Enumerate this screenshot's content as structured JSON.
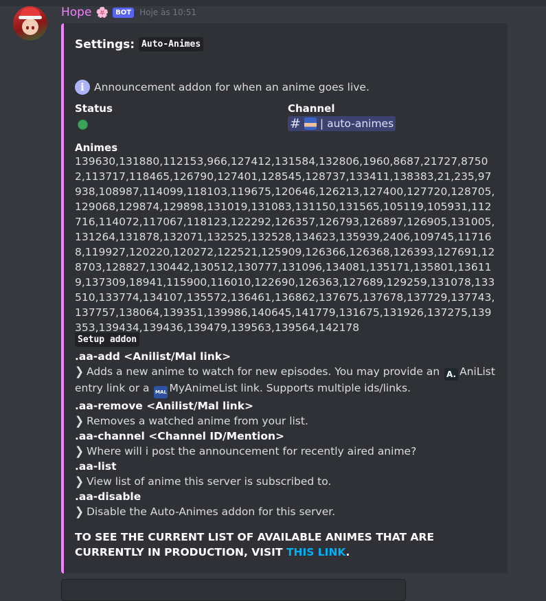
{
  "message": {
    "username": "Hope",
    "flower_emoji": "🌸",
    "bot_tag": "BOT",
    "timestamp": "Hoje às 10:51"
  },
  "embed": {
    "accent_color": "#f47fff",
    "title_prefix": "Settings:",
    "title_code": "Auto-Animes",
    "info_icon": "info-icon",
    "description": "Announcement addon for when an anime goes live.",
    "fields": {
      "status": {
        "name": "Status",
        "value_icon": "green-dot",
        "value_color": "#3ba55c"
      },
      "channel": {
        "name": "Channel",
        "mention_hash": "#",
        "mention_text": "| auto-animes"
      },
      "animes": {
        "name": "Animes",
        "value": "139630,131880,112153,966,127412,131584,132806,1960,8687,21727,87502,113717,118465,126790,127401,128545,128737,133411,138383,21,235,97938,108987,114099,118103,119675,120646,126213,127400,127720,128705,129068,129874,129898,131019,131083,131150,131565,105119,105931,112716,114072,117067,118123,122292,126357,126793,126897,126905,131005,131264,131878,132071,132525,132528,134623,135939,2406,109745,117168,119927,120220,120272,122521,125909,126366,126368,126393,127691,128703,128827,130442,130512,130777,131096,134081,135171,135801,136119,137309,18941,115900,116010,122690,126363,127689,129259,131078,133510,133774,134107,135572,136461,136862,137675,137678,137729,137743,137757,138064,139351,139986,140645,141779,131675,131926,137275,139353,139434,139436,139479,139563,139564,142178"
      }
    },
    "setup_label": "Setup addon",
    "commands": [
      {
        "name": ".aa-add <Anilist/Mal link>",
        "desc_a": "Adds a new anime to watch for new episodes. You may provide an",
        "anilist_badge": "A.",
        "anilist_text": "AniList entry link or a",
        "mal_badge": "MAL",
        "mal_text": "MyAnimeList link. Supports multiple ids/links."
      },
      {
        "name": ".aa-remove <Anilist/Mal link>",
        "desc": "Removes a watched anime from your list."
      },
      {
        "name": ".aa-channel <Channel ID/Mention>",
        "desc": "Where will i post the announcement for recently aired anime?"
      },
      {
        "name": ".aa-list",
        "desc": "View list of anime this server is subscribed to."
      },
      {
        "name": ".aa-disable",
        "desc": "Disable the Auto-Animes addon for this server."
      }
    ],
    "footer_text": "TO SEE THE CURRENT LIST OF AVAILABLE ANIMES THAT ARE CURRENTLY IN PRODUCTION, VISIT",
    "footer_link": "THIS LINK",
    "footer_end": "."
  }
}
